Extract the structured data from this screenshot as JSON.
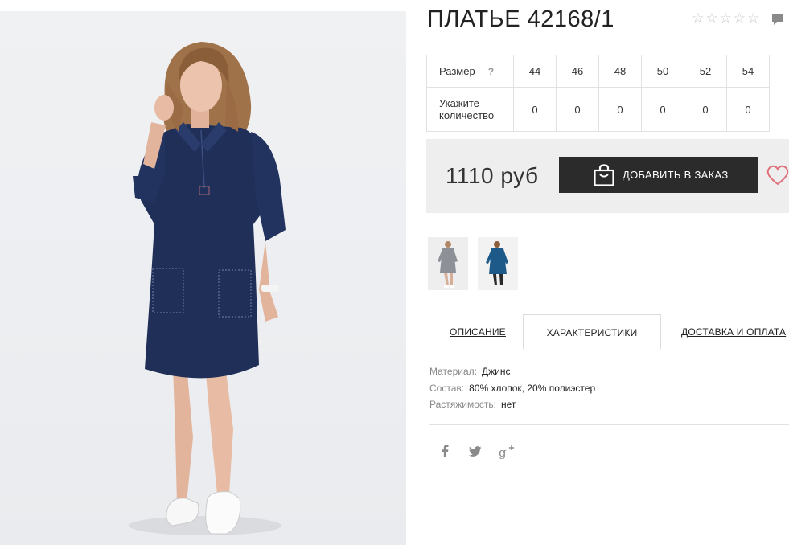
{
  "product": {
    "title": "ПЛАТЬЕ 42168/1",
    "image_alt": "dress-photo"
  },
  "rating": {
    "stars": [
      "☆",
      "☆",
      "☆",
      "☆",
      "☆"
    ],
    "value": 0,
    "max": 5
  },
  "sizes_table": {
    "size_label": "Размер",
    "help_mark": "?",
    "qty_label": "Укажите количество",
    "sizes": [
      "44",
      "46",
      "48",
      "50",
      "52",
      "54"
    ],
    "quantities": [
      "0",
      "0",
      "0",
      "0",
      "0",
      "0"
    ]
  },
  "purchase": {
    "price": "1110 руб",
    "add_button_label": "ДОБАВИТЬ В ЗАКАЗ"
  },
  "tabs": {
    "description": "ОПИСАНИЕ",
    "characteristics": "ХАРАКТЕРИСТИКИ",
    "shipping": "ДОСТАВКА И ОПЛАТА",
    "active": "characteristics"
  },
  "characteristics": {
    "material_key": "Материал:",
    "material_value": "Джинс",
    "composition_key": "Состав:",
    "composition_value": "80% хлопок, 20% полиэстер",
    "stretch_key": "Растяжимость:",
    "stretch_value": "нет"
  },
  "social": {
    "icons": [
      "facebook-icon",
      "twitter-icon",
      "google-plus-icon"
    ]
  },
  "colors": {
    "accent_dark": "#2b2b2b",
    "heart": "#e0707a",
    "price_box": "#eeeeee",
    "dress": "#1f2f58"
  }
}
